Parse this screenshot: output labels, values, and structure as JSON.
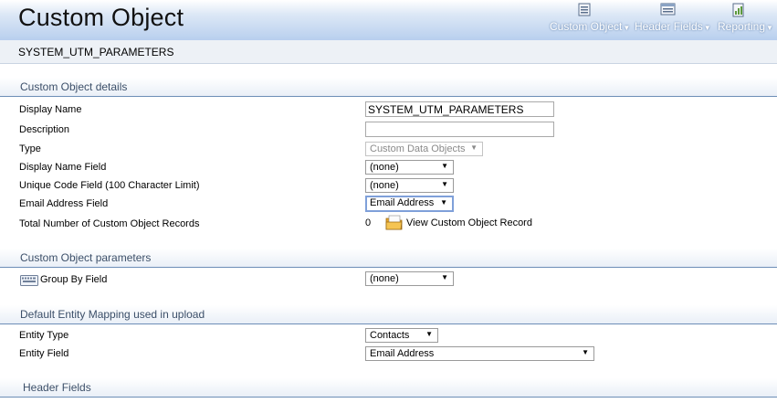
{
  "header": {
    "title": "Custom Object",
    "menus": [
      {
        "label": "Custom Object",
        "icon": "custom-object-icon"
      },
      {
        "label": "Header Fields",
        "icon": "header-fields-icon"
      },
      {
        "label": "Reporting",
        "icon": "reporting-icon"
      }
    ]
  },
  "subheader": {
    "name": "SYSTEM_UTM_PARAMETERS"
  },
  "details": {
    "title": "Custom Object details",
    "display_name": {
      "label": "Display Name",
      "value": "SYSTEM_UTM_PARAMETERS"
    },
    "description": {
      "label": "Description",
      "value": ""
    },
    "type": {
      "label": "Type",
      "value": "Custom Data Objects"
    },
    "display_name_field": {
      "label": "Display Name Field",
      "value": "(none)"
    },
    "unique_code_field": {
      "label": "Unique Code Field (100 Character Limit)",
      "value": "(none)"
    },
    "email_address_field": {
      "label": "Email Address Field",
      "value": "Email Address"
    },
    "total_records": {
      "label": "Total Number of Custom Object Records",
      "value": "0",
      "link": "View Custom Object Record"
    }
  },
  "parameters": {
    "title": "Custom Object parameters",
    "group_by": {
      "label": "Group By Field",
      "value": "(none)",
      "icon": "keyboard-icon"
    }
  },
  "mapping": {
    "title": "Default Entity Mapping used in upload",
    "entity_type": {
      "label": "Entity Type",
      "value": "Contacts"
    },
    "entity_field": {
      "label": "Entity Field",
      "value": "Email Address"
    }
  },
  "header_fields": {
    "title": "Header Fields"
  },
  "colors": {
    "header_gradient_end": "#b8cfee",
    "section_rule": "#6d8eb7",
    "section_text": "#3c4f69"
  }
}
